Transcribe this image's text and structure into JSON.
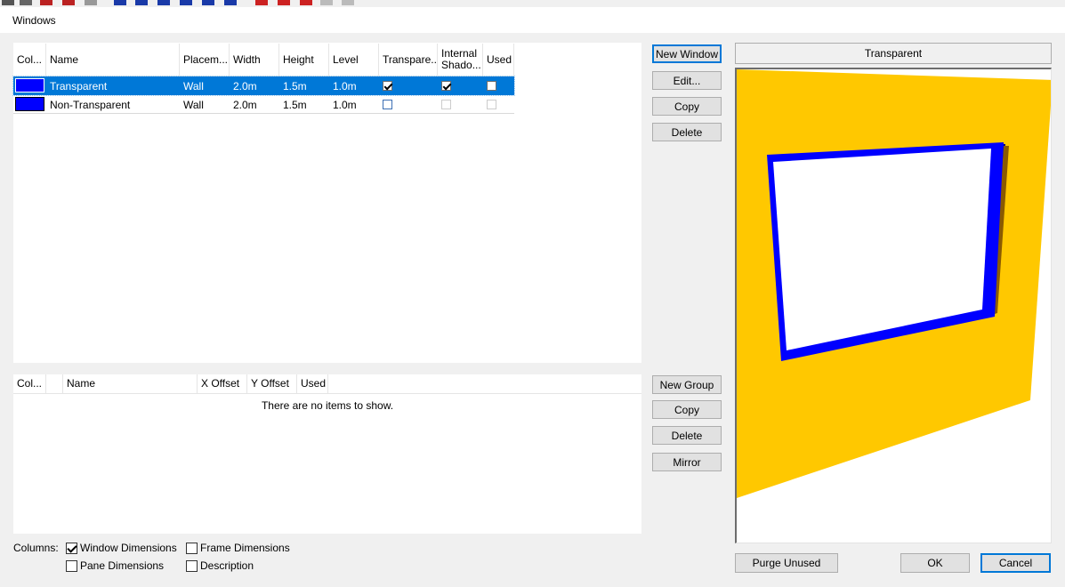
{
  "window": {
    "title": "Windows"
  },
  "windows_table": {
    "columns": [
      "Col...",
      "Name",
      "Placem...",
      "Width",
      "Height",
      "Level",
      "Transpare...",
      "Internal Shado...",
      "Used"
    ],
    "rows": [
      {
        "color": "#0000ff",
        "name": "Transparent",
        "placement": "Wall",
        "width": "2.0m",
        "height": "1.5m",
        "level": "1.0m",
        "transparent": true,
        "internal_shadow": true,
        "used": false,
        "selected": true
      },
      {
        "color": "#0000ff",
        "name": "Non-Transparent",
        "placement": "Wall",
        "width": "2.0m",
        "height": "1.5m",
        "level": "1.0m",
        "transparent": false,
        "internal_shadow": false,
        "used": false,
        "selected": false
      }
    ]
  },
  "window_buttons": {
    "new": "New Window",
    "edit": "Edit...",
    "copy": "Copy",
    "delete": "Delete"
  },
  "groups_table": {
    "columns": [
      "Col...",
      "",
      "Name",
      "X Offset",
      "Y Offset",
      "Used"
    ],
    "empty_text": "There are no items to show."
  },
  "group_buttons": {
    "new": "New Group",
    "copy": "Copy",
    "delete": "Delete",
    "mirror": "Mirror"
  },
  "preview": {
    "title": "Transparent",
    "wall_color": "#ffc800",
    "frame_color": "#0000ff"
  },
  "columns_options": {
    "label": "Columns:",
    "window_dimensions": {
      "label": "Window Dimensions",
      "checked": true
    },
    "frame_dimensions": {
      "label": "Frame Dimensions",
      "checked": false
    },
    "pane_dimensions": {
      "label": "Pane Dimensions",
      "checked": false
    },
    "description": {
      "label": "Description",
      "checked": false
    }
  },
  "footer_buttons": {
    "purge": "Purge Unused",
    "ok": "OK",
    "cancel": "Cancel"
  }
}
